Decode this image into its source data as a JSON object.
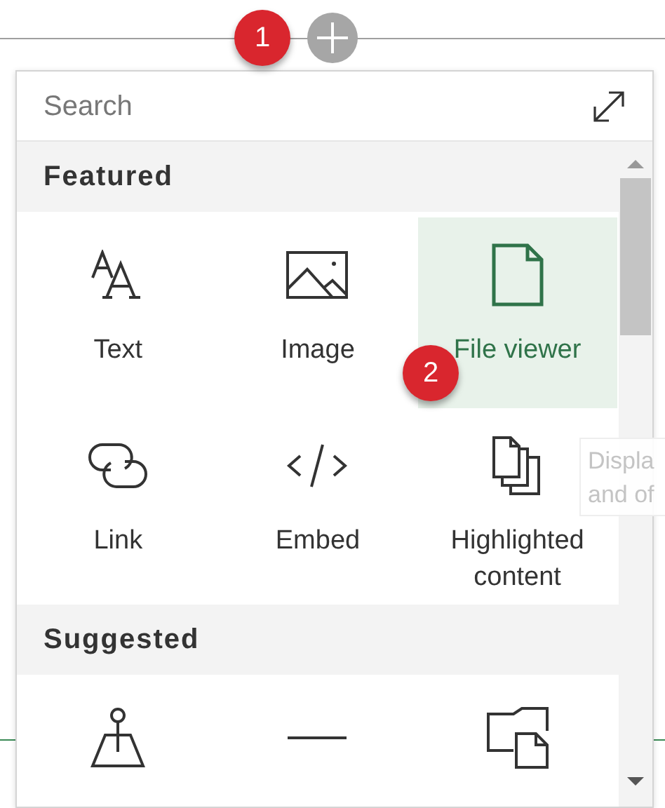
{
  "callouts": [
    {
      "label": "1"
    },
    {
      "label": "2"
    }
  ],
  "search": {
    "placeholder": "Search"
  },
  "sections": [
    {
      "title": "Featured",
      "items": [
        {
          "label": "Text",
          "kind": "text",
          "selected": false
        },
        {
          "label": "Image",
          "kind": "image",
          "selected": false
        },
        {
          "label": "File viewer",
          "kind": "file",
          "selected": true
        },
        {
          "label": "Link",
          "kind": "link",
          "selected": false
        },
        {
          "label": "Embed",
          "kind": "embed",
          "selected": false
        },
        {
          "label": "Highlighted content",
          "kind": "stack",
          "selected": false
        }
      ]
    },
    {
      "title": "Suggested",
      "items": [
        {
          "kind": "pin",
          "selected": false
        },
        {
          "kind": "divider",
          "selected": false
        },
        {
          "kind": "docs",
          "selected": false
        }
      ]
    }
  ],
  "tooltip": {
    "lines": [
      "Displa",
      "and of"
    ]
  }
}
